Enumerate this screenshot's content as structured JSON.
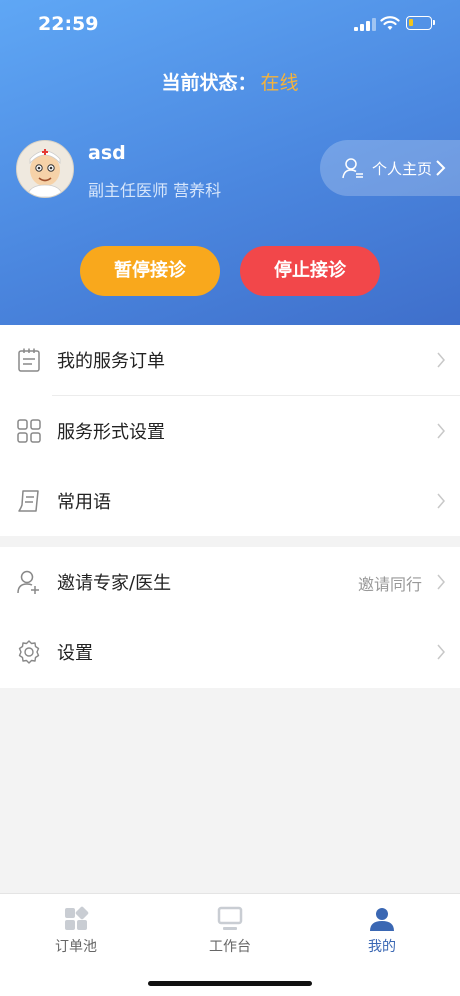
{
  "status_bar": {
    "time": "22:59"
  },
  "header": {
    "status_label": "当前状态：",
    "status_value": "在线",
    "profile": {
      "name": "asd",
      "title": "副主任医师 营养科"
    },
    "homepage_label": "个人主页",
    "pause_button": "暂停接诊",
    "stop_button": "停止接诊"
  },
  "menu_group1": [
    {
      "label": "我的服务订单",
      "icon": "clipboard-icon"
    },
    {
      "label": "服务形式设置",
      "icon": "grid-icon"
    },
    {
      "label": "常用语",
      "icon": "scroll-icon"
    }
  ],
  "menu_group2": [
    {
      "label": "邀请专家/医生",
      "extra": "邀请同行",
      "icon": "add-user-icon"
    },
    {
      "label": "设置",
      "icon": "gear-icon"
    }
  ],
  "tabbar": [
    {
      "label": "订单池",
      "icon": "orders-icon",
      "active": false
    },
    {
      "label": "工作台",
      "icon": "monitor-icon",
      "active": false
    },
    {
      "label": "我的",
      "icon": "user-icon",
      "active": true
    }
  ],
  "colors": {
    "accent": "#3a67b3",
    "online": "#f5b33b",
    "pause": "#f9a81c",
    "stop": "#f2474a"
  }
}
